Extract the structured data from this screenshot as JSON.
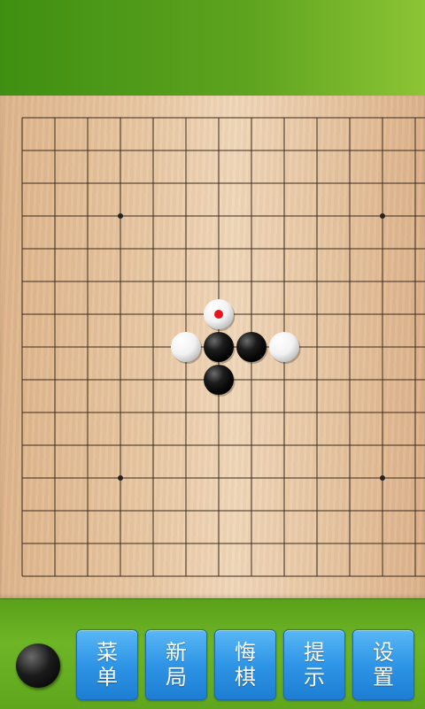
{
  "buttons": {
    "menu": [
      "菜",
      "单"
    ],
    "new_game": [
      "新",
      "局"
    ],
    "undo": [
      "悔",
      "棋"
    ],
    "hint": [
      "提",
      "示"
    ],
    "settings": [
      "设",
      "置"
    ]
  },
  "game": {
    "board_size": 15,
    "current_turn": "black",
    "star_points": [
      [
        3,
        3
      ],
      [
        11,
        3
      ],
      [
        3,
        11
      ],
      [
        11,
        11
      ]
    ],
    "stones": [
      {
        "col": 6,
        "row": 6,
        "color": "white",
        "last_move": true
      },
      {
        "col": 5,
        "row": 7,
        "color": "white"
      },
      {
        "col": 6,
        "row": 7,
        "color": "black"
      },
      {
        "col": 7,
        "row": 7,
        "color": "black"
      },
      {
        "col": 8,
        "row": 7,
        "color": "white"
      },
      {
        "col": 6,
        "row": 8,
        "color": "black"
      }
    ],
    "last_move_marker_color": "#e8141c"
  },
  "colors": {
    "button_blue": "#2f95e6",
    "bar_green": "#5fa41f",
    "board_wood": "#e8c7a2"
  }
}
